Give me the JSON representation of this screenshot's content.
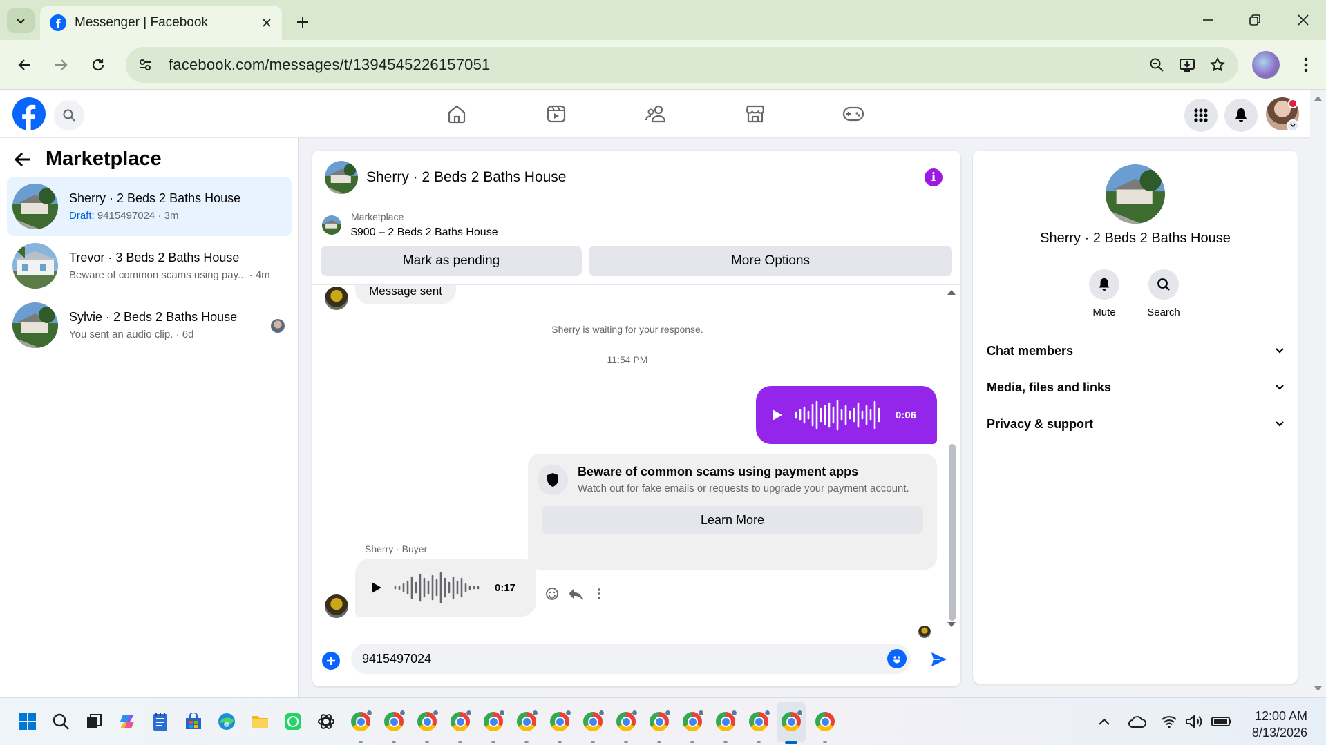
{
  "browser": {
    "tab_title": "Messenger | Facebook",
    "url": "facebook.com/messages/t/1394545226157051"
  },
  "sidebar": {
    "title": "Marketplace",
    "conversations": [
      {
        "name": "Sherry · 2 Beds 2 Baths House",
        "draft_label": "Draft:",
        "preview": " 9415497024 · 3m",
        "active": true
      },
      {
        "name": "Trevor · 3 Beds 2 Baths House",
        "preview": "Beware of common scams using pay... · 4m",
        "active": false
      },
      {
        "name": "Sylvie · 2 Beds 2 Baths House",
        "preview": "You sent an audio clip. · 6d",
        "active": false
      }
    ]
  },
  "chat": {
    "title": "Sherry · 2 Beds 2 Baths House",
    "listing_label": "Marketplace",
    "listing_title": "$900 – 2 Beds 2 Baths House",
    "mark_pending_label": "Mark as pending",
    "more_options_label": "More Options",
    "message_sent_text": "Message sent",
    "waiting_note": "Sherry is waiting for your response.",
    "timestamp": "11:54 PM",
    "sent_audio_duration": "0:06",
    "scam_title": "Beware of common scams using payment apps",
    "scam_text": "Watch out for fake emails or requests to upgrade your payment account.",
    "learn_more_label": "Learn More",
    "buyer_label": "Sherry · Buyer",
    "received_audio_duration": "0:17",
    "composer_value": "9415497024"
  },
  "info_panel": {
    "name": "Sherry · 2 Beds 2 Baths House",
    "mute_label": "Mute",
    "search_label": "Search",
    "sections": [
      "Chat members",
      "Media, files and links",
      "Privacy & support"
    ]
  },
  "taskbar": {
    "time": "12:00 AM",
    "date": "8/13/2026"
  },
  "colors": {
    "facebook_blue": "#0866ff",
    "sent_bubble": "#9326ea",
    "active_conversation": "#e7f3ff"
  }
}
